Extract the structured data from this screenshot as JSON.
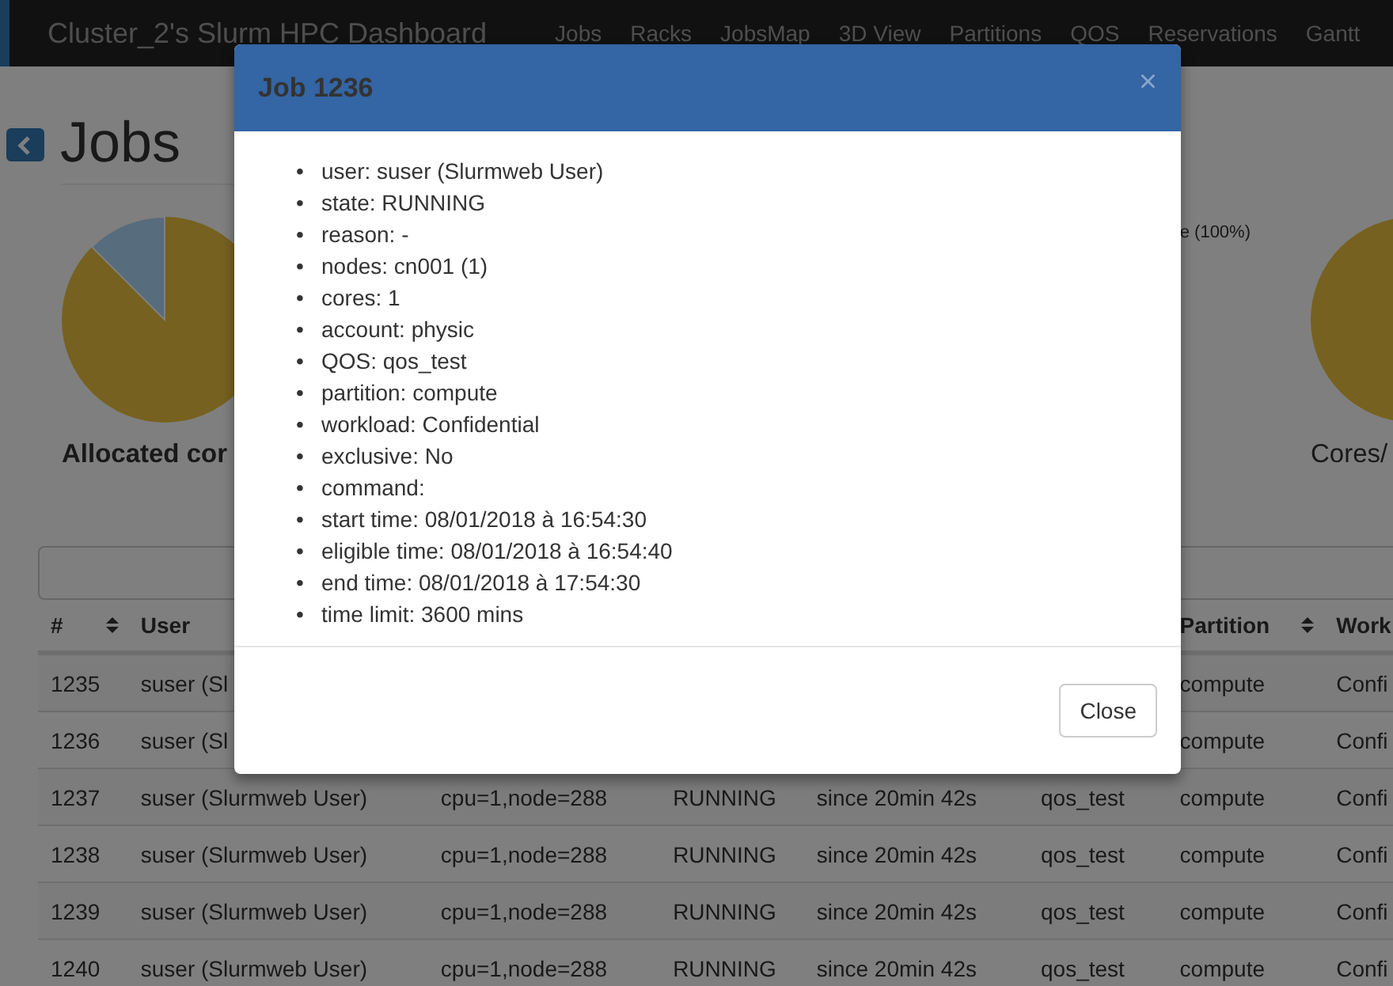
{
  "navbar": {
    "brand": "Cluster_2's Slurm HPC Dashboard",
    "items": [
      {
        "label": "Jobs"
      },
      {
        "label": "Racks"
      },
      {
        "label": "JobsMap"
      },
      {
        "label": "3D View"
      },
      {
        "label": "Partitions"
      },
      {
        "label": "QOS"
      },
      {
        "label": "Reservations"
      },
      {
        "label": "Gantt"
      }
    ]
  },
  "page": {
    "title": "Jobs"
  },
  "charts": {
    "left_label": "Allocated cor",
    "right_legend": "e (100%)",
    "right_label": "Cores/"
  },
  "table": {
    "columns": [
      "#",
      "User",
      "Partition",
      "Work"
    ],
    "rows": [
      {
        "id": "1235",
        "user": "suser (Sl",
        "partition": "compute",
        "workload": "Confi"
      },
      {
        "id": "1236",
        "user": "suser (Sl",
        "partition": "compute",
        "workload": "Confi"
      },
      {
        "id": "1237",
        "user": "suser (Slurmweb User)",
        "resources": "cpu=1,node=288",
        "state": "RUNNING",
        "time": "since 20min 42s",
        "qos": "qos_test",
        "partition": "compute",
        "workload": "Confi"
      },
      {
        "id": "1238",
        "user": "suser (Slurmweb User)",
        "resources": "cpu=1,node=288",
        "state": "RUNNING",
        "time": "since 20min 42s",
        "qos": "qos_test",
        "partition": "compute",
        "workload": "Confi"
      },
      {
        "id": "1239",
        "user": "suser (Slurmweb User)",
        "resources": "cpu=1,node=288",
        "state": "RUNNING",
        "time": "since 20min 42s",
        "qos": "qos_test",
        "partition": "compute",
        "workload": "Confi"
      },
      {
        "id": "1240",
        "user": "suser (Slurmweb User)",
        "resources": "cpu=1,node=288",
        "state": "RUNNING",
        "time": "since 20min 42s",
        "qos": "qos_test",
        "partition": "compute",
        "workload": "Confi"
      }
    ]
  },
  "modal": {
    "title": "Job 1236",
    "close_glyph": "×",
    "bullet": "•",
    "details": [
      "user: suser (Slurmweb User)",
      "state: RUNNING",
      "reason: -",
      "nodes: cn001 (1)",
      "cores: 1",
      "account: physic",
      "QOS: qos_test",
      "partition: compute",
      "workload: Confidential",
      "exclusive: No",
      "command:",
      "start time: 08/01/2018 à 16:54:30",
      "eligible time: 08/01/2018 à 16:54:40",
      "end time: 08/01/2018 à 17:54:30",
      "time limit: 3600 mins"
    ],
    "button": "Close"
  }
}
